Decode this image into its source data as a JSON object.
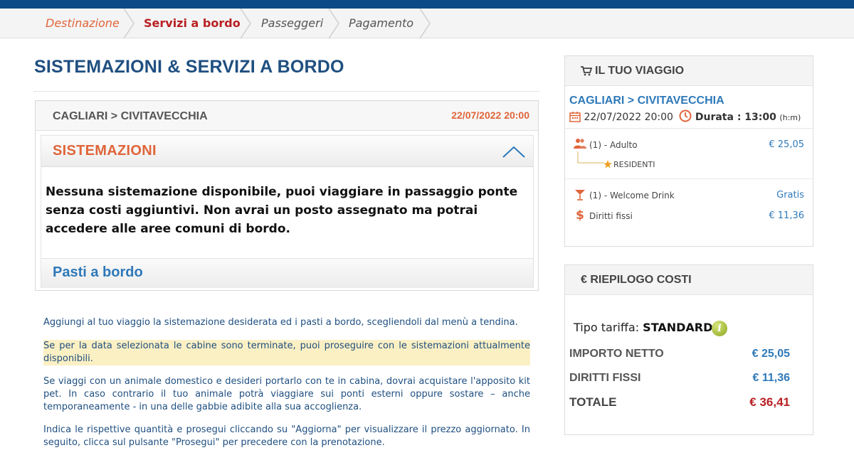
{
  "steps": [
    {
      "label": "Destinazione",
      "state": "done"
    },
    {
      "label": "Servizi a bordo",
      "state": "active"
    },
    {
      "label": "Passeggeri",
      "state": "todo"
    },
    {
      "label": "Pagamento",
      "state": "todo"
    }
  ],
  "page_title": "SISTEMAZIONI & SERVIZI A BORDO",
  "route": {
    "name": "CAGLIARI > CIVITAVECCHIA",
    "date": "22/07/2022 20:00"
  },
  "sistemazioni": {
    "title": "SISTEMAZIONI",
    "message": "Nessuna sistemazione disponibile, puoi viaggiare in passaggio ponte senza costi aggiuntivi. Non avrai un posto assegnato ma potrai accedere alle aree comuni di bordo."
  },
  "pasti": {
    "title": "Pasti a bordo"
  },
  "info": [
    "Aggiungi al tuo viaggio la sistemazione desiderata ed i pasti a bordo, scegliendoli dal menù a tendina.",
    "Se per la data selezionata le cabine sono terminate, puoi proseguire con le sistemazioni attualmente disponibili.",
    "Se viaggi con un animale domestico e desideri portarlo con te in cabina, dovrai acquistare l'apposito kit pet. In caso contrario il tuo animale potrà viaggiare sui ponti esterni oppure sostare – anche temporaneamente - in una delle gabbie adibite alla sua accoglienza.",
    "Indica le rispettive quantità  e prosegui cliccando su \"Aggiorna\" per visualizzare il prezzo aggiornato. In seguito, clicca sul pulsante \"Prosegui\" per precedere con la prenotazione."
  ],
  "trip": {
    "header": "IL TUO VIAGGIO",
    "route": "CAGLIARI > CIVITAVECCHIA",
    "datetime": "22/07/2022 20:00",
    "duration_label": "Durata : 13:00",
    "duration_unit": "(h:m)",
    "items": [
      {
        "label": "(1) - Adulto",
        "price": "€ 25,05",
        "icon": "passenger-icon"
      },
      {
        "label": "(1) - Welcome Drink",
        "price": "Gratis",
        "icon": "cocktail-icon"
      },
      {
        "label": "Diritti fissi",
        "price": "€ 11,36",
        "icon": "dollar-icon"
      }
    ],
    "residents_label": "RESIDENTI"
  },
  "costs": {
    "header": "€ RIEPILOGO COSTI",
    "tariff_label": "Tipo tariffa:",
    "tariff_value": "STANDARD",
    "rows": [
      {
        "label": "IMPORTO NETTO",
        "value": "€ 25,05"
      },
      {
        "label": "DIRITTI FISSI",
        "value": "€ 11,36"
      },
      {
        "label": "TOTALE",
        "value": "€ 36,41"
      }
    ]
  },
  "colors": {
    "navy": "#0b4a86",
    "title_blue": "#1f4f80",
    "link_blue": "#2e79b9",
    "orange": "#e0653a",
    "red": "#b82023",
    "highlight": "#fbf0c4"
  }
}
